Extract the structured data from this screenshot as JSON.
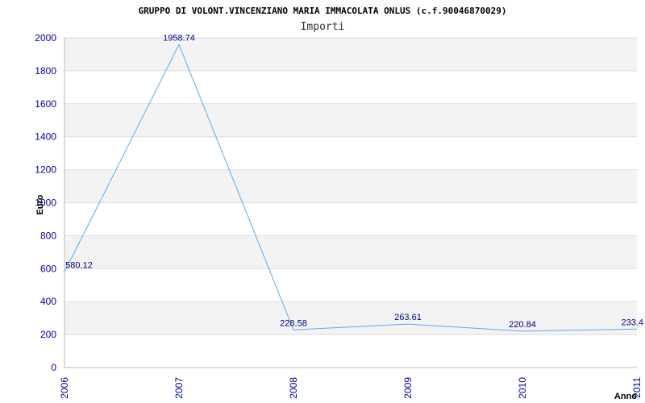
{
  "chart_data": {
    "type": "line",
    "title": "GRUPPO DI VOLONT.VINCENZIANO MARIA IMMACOLATA ONLUS (c.f.90046870029)",
    "subtitle": "Importi",
    "xlabel": "Anno",
    "ylabel": "Euro",
    "x": [
      "2006",
      "2007",
      "2008",
      "2009",
      "2010",
      "2011"
    ],
    "series": [
      {
        "values": [
          580.12,
          1958.74,
          228.58,
          263.61,
          220.84,
          233.4
        ]
      }
    ],
    "data_labels": [
      "580.12",
      "1958.74",
      "228.58",
      "263.61",
      "220.84",
      "233.4"
    ],
    "ylim": [
      0,
      2000
    ],
    "yticks": [
      0,
      200,
      400,
      600,
      800,
      1000,
      1200,
      1400,
      1600,
      1800,
      2000
    ],
    "grid": true,
    "colors": {
      "line": "#5aaaee",
      "band": "#f3f3f3",
      "grid": "#dddddd",
      "tick_text": "#0000aa",
      "label_text": "#000080"
    }
  }
}
